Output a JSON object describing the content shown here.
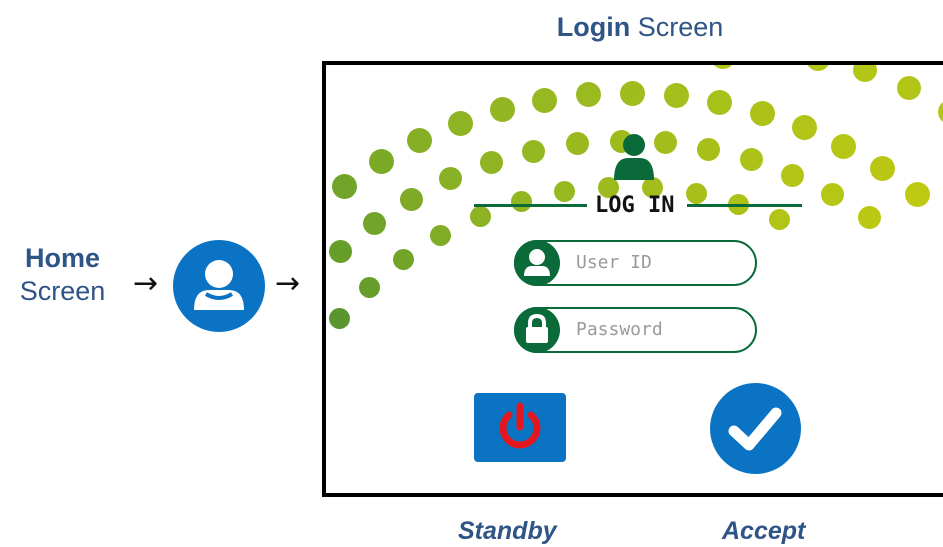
{
  "title": {
    "bold": "Login",
    "rest": " Screen"
  },
  "home_label": {
    "bold": "Home",
    "rest": "Screen"
  },
  "arrow": "→",
  "login": {
    "heading": "LOG IN",
    "user_placeholder": "User ID",
    "password_placeholder": "Password"
  },
  "captions": {
    "standby": "Standby",
    "accept": "Accept"
  },
  "colors": {
    "brand_blue": "#0a73c4",
    "text_blue": "#2f5486",
    "dark_green": "#0b6a3a",
    "power_red": "#e3171f"
  },
  "icons": {
    "home": "user-icon",
    "login": "user-icon",
    "user_field": "user-icon",
    "password_field": "lock-icon",
    "standby": "power-icon",
    "accept": "checkmark-icon"
  }
}
